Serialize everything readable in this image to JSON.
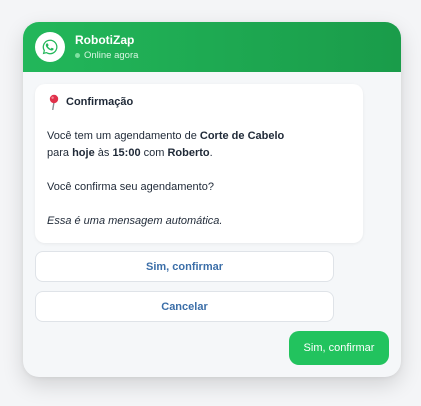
{
  "header": {
    "bot_name": "RobotiZap",
    "status": "Online agora"
  },
  "message": {
    "title": "Confirmação",
    "line1": {
      "before": "Você tem um agendamento de ",
      "service": "Corte de Cabelo"
    },
    "line2": {
      "prefix": "para ",
      "day": "hoje",
      "at": " às ",
      "time": "15:00",
      "with": " com ",
      "person": "Roberto",
      "end": "."
    },
    "question": "Você confirma seu agendamento?",
    "note": "Essa é uma mensagem automática."
  },
  "options": {
    "confirm_label": "Sim, confirmar",
    "cancel_label": "Cancelar"
  },
  "user_reply": "Sim, confirmar",
  "colors": {
    "header_green": "#22b75a",
    "reply_green": "#22c35e",
    "option_text": "#3b6ea8"
  }
}
